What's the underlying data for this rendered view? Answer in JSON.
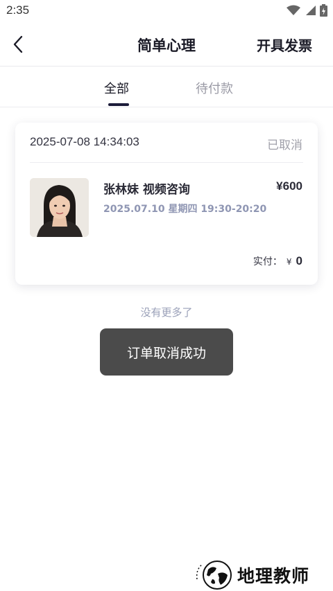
{
  "status_bar": {
    "time": "2:35"
  },
  "header": {
    "title": "简单心理",
    "invoice_label": "开具发票"
  },
  "tabs": [
    {
      "label": "全部",
      "active": true
    },
    {
      "label": "待付款",
      "active": false
    }
  ],
  "order": {
    "time": "2025-07-08 14:34:03",
    "status": "已取消",
    "service_name": "张林妹 视频咨询",
    "price": "¥600",
    "appointment": "2025.07.10 星期四 19:30-20:20",
    "paid_label": "实付：",
    "paid_currency": "¥",
    "paid_amount": "0"
  },
  "list_end_text": "没有更多了",
  "toast": {
    "message": "订单取消成功"
  },
  "watermark": {
    "text": "地理教师"
  },
  "colors": {
    "accent": "#1c1c3a",
    "muted_text": "#a0a0aa",
    "appointment_text": "#8f96b3",
    "toast_bg": "#323232"
  }
}
